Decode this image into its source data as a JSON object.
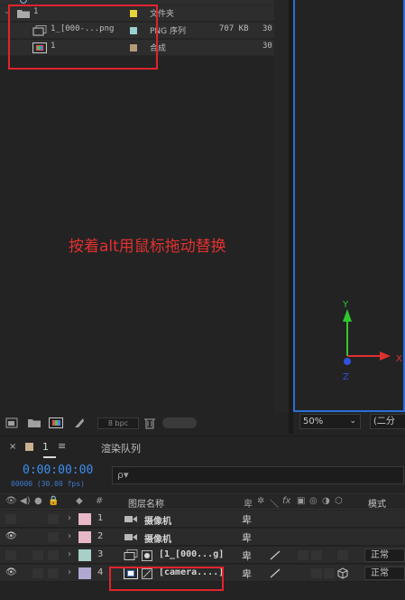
{
  "project": {
    "rows": [
      {
        "name": "1",
        "type": "文件夹",
        "size": "",
        "frames": "",
        "swatch": "#e8d23a"
      },
      {
        "name": "1_[000-...png",
        "type": "PNG 序列",
        "size": "707 KB",
        "frames": "30",
        "swatch": "#9ad0cf"
      },
      {
        "name": "1",
        "type": "合成",
        "size": "",
        "frames": "30",
        "swatch": "#b49a7a"
      }
    ],
    "bpc": "8 bpc",
    "annotation": "按着alt用鼠标拖动替换"
  },
  "viewer": {
    "axis_y": "Y",
    "axis_x": "X",
    "axis_z": "Z",
    "zoom": "50%",
    "resolution": "(二分"
  },
  "timeline": {
    "tab_comp": "1",
    "tab_render": "渲染队列",
    "timecode": "0:00:00:00",
    "frame_info": "00000 (30.00 fps)",
    "search_icon_text": "ρ▾",
    "col_num": "#",
    "col_layer_name": "图层名称",
    "col_mode": "模式",
    "layers": [
      {
        "num": "1",
        "name": "摄像机",
        "mode": "",
        "label_color": "#e8b8c8"
      },
      {
        "num": "2",
        "name": "摄像机",
        "mode": "",
        "label_color": "#e8b8c8"
      },
      {
        "num": "3",
        "name": "[1_[000...g]",
        "mode": "正常",
        "label_color": "#a8d0c8"
      },
      {
        "num": "4",
        "name": "[camera....]",
        "mode": "正常",
        "label_color": "#b0a8d0"
      }
    ]
  },
  "colors": {
    "accent_blue": "#2a6fd6",
    "annotation_red": "#e0242d",
    "timecode_blue": "#3d8ef0"
  }
}
